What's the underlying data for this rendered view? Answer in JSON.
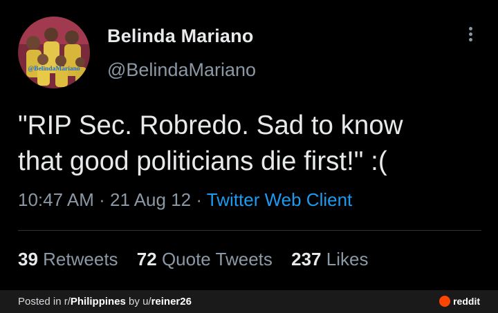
{
  "tweet": {
    "avatar_watermark": "@BelindaMariano",
    "display_name": "Belinda Mariano",
    "handle": "@BelindaMariano",
    "text_line1": "\"RIP Sec. Robredo. Sad to know",
    "text_line2": "that good politicians die first!\" :(",
    "time": "10:47 AM",
    "date": "21 Aug 12",
    "source": "Twitter Web Client",
    "separator": "·",
    "stats": {
      "retweets_count": "39",
      "retweets_label": "Retweets",
      "quotes_count": "72",
      "quotes_label": "Quote Tweets",
      "likes_count": "237",
      "likes_label": "Likes"
    }
  },
  "footer": {
    "posted_prefix": "Posted in r/",
    "subreddit": "Philippines",
    "by_text": " by u/",
    "username": "reiner26",
    "brand": "reddit"
  },
  "colors": {
    "background": "#000000",
    "text_primary": "#e7e9ea",
    "text_secondary": "#8b98a5",
    "link": "#1d9bf0",
    "footer_bg": "#1a1a1b",
    "reddit_orange": "#ff4500"
  },
  "icons": {
    "more": "more-vertical-icon",
    "reddit_logo": "reddit-logo-icon"
  }
}
